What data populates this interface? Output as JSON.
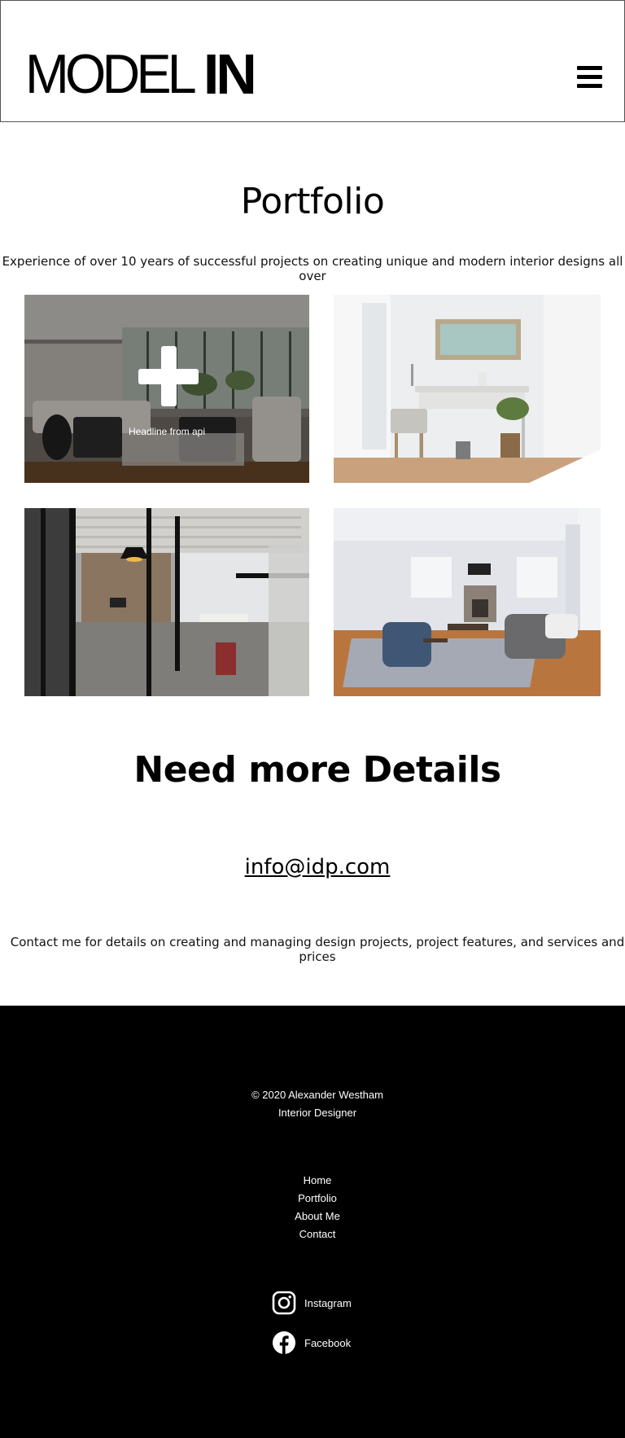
{
  "header": {
    "logo_light": "MODEL",
    "logo_bold": "IN",
    "menu_icon": "hamburger-menu-icon"
  },
  "portfolio": {
    "title": "Portfolio",
    "subtitle": "Experience of over 10 years of successful projects on creating unique and modern interior designs all over",
    "tiles": [
      {
        "image": "living-room-photo",
        "caption": "Headline from api",
        "overlay_icon": "plus-icon"
      },
      {
        "image": "desk-vignette-photo"
      },
      {
        "image": "glass-partition-office-photo"
      },
      {
        "image": "bright-living-room-photo"
      }
    ]
  },
  "details": {
    "title": "Need more Details",
    "email": "info@idp.com",
    "contact_text": "Contact me for details on creating and managing design projects, project features, and services and prices"
  },
  "footer": {
    "copyright": "© 2020 Alexander Westham",
    "role": "Interior Designer",
    "nav": [
      "Home",
      "Portfolio",
      "About Me",
      "Contact"
    ],
    "social": [
      {
        "label": "Instagram",
        "icon": "instagram-icon"
      },
      {
        "label": "Facebook",
        "icon": "facebook-icon"
      }
    ]
  },
  "colors": {
    "footer_bg": "#000000",
    "page_bg": "#ffffff",
    "text": "#000000"
  }
}
